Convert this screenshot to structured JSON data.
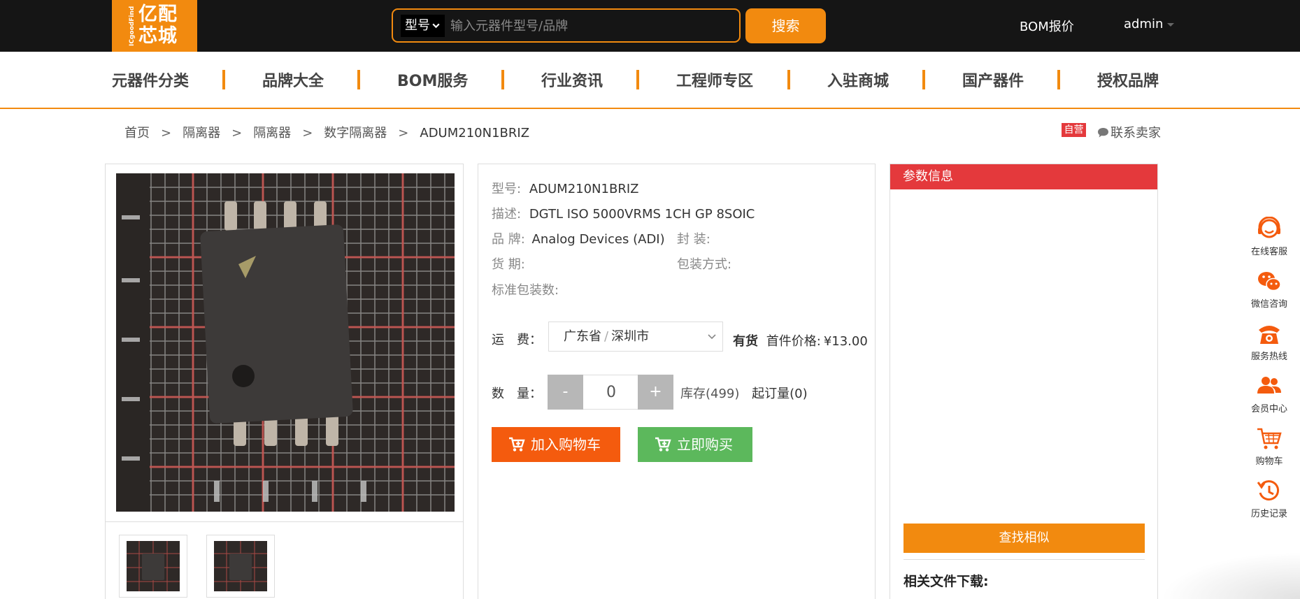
{
  "header": {
    "logo": {
      "cn": "亿配芯城",
      "en": "ICgoodFind"
    },
    "search": {
      "type": "型号",
      "placeholder": "输入元器件型号/品牌",
      "button": "搜索"
    },
    "bom_quote": "BOM报价",
    "user": "admin"
  },
  "nav": {
    "items": [
      "元器件分类",
      "品牌大全",
      "BOM服务",
      "行业资讯",
      "工程师专区",
      "入驻商城",
      "国产器件",
      "授权品牌"
    ]
  },
  "breadcrumb": [
    "首页",
    "隔离器",
    "隔离器",
    "数字隔离器",
    "ADUM210N1BRIZ"
  ],
  "breadcrumb_sep": ">",
  "badge": "自营",
  "contact_seller": "联系卖家",
  "product": {
    "model_label": "型号:",
    "model": "ADUM210N1BRIZ",
    "desc_label": "描述:",
    "desc": "DGTL ISO 5000VRMS 1CH GP 8SOIC",
    "brand_label": "品 牌:",
    "brand": "Analog Devices (ADI)",
    "package_label": "封 装:",
    "lead_label": "货 期:",
    "packing_label": "包装方式:",
    "std_pack_label": "标准包装数:",
    "ship_label": "运　费：",
    "ship_province": "广东省",
    "ship_city": "深圳市",
    "in_stock": "有货",
    "first_price_label": "首件价格:",
    "first_price": "¥13.00",
    "qty_label": "数　量：",
    "qty_minus": "-",
    "qty_value": "0",
    "qty_plus": "+",
    "stock": "库存(499)",
    "moq": "起订量(0)",
    "add_cart": "加入购物车",
    "buy_now": "立即购买"
  },
  "params": {
    "title": "参数信息",
    "find_similar": "查找相似",
    "files_title": "相关文件下载:"
  },
  "sidebar": [
    {
      "label": "在线客服",
      "icon": "headset-icon"
    },
    {
      "label": "微信咨询",
      "icon": "wechat-icon"
    },
    {
      "label": "服务热线",
      "icon": "phone-icon"
    },
    {
      "label": "会员中心",
      "icon": "members-icon"
    },
    {
      "label": "购物车",
      "icon": "cart-icon"
    },
    {
      "label": "历史记录",
      "icon": "history-icon"
    }
  ],
  "colors": {
    "brand_orange": "#f28a0f",
    "red": "#e4393c",
    "green": "#5cb85c",
    "cart_orange": "#f45b0e",
    "topbar": "#151515"
  }
}
